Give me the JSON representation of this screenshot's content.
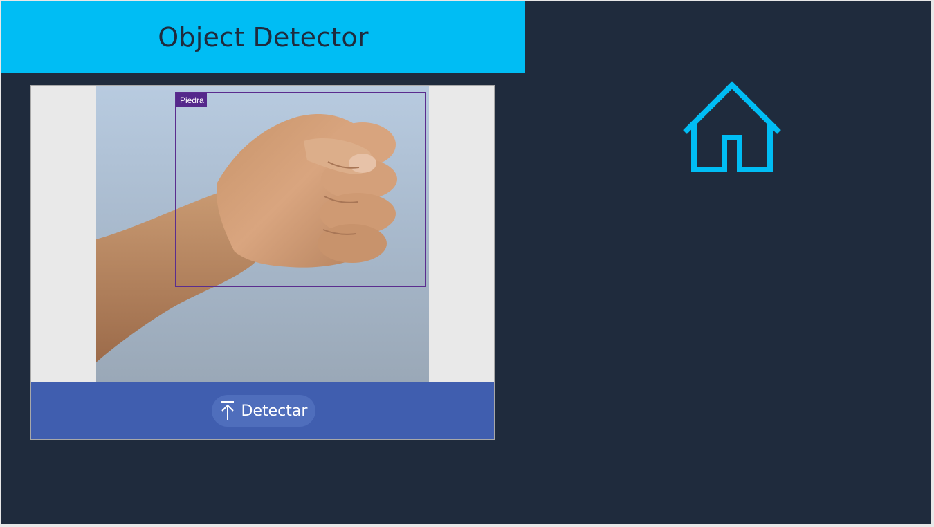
{
  "app": {
    "title": "Object Detector"
  },
  "detection": {
    "label": "Piedra",
    "image_icon": "raised-fist-photo"
  },
  "actions": {
    "detect_label": "Detectar",
    "detect_icon": "upload-arrow-icon",
    "home_icon": "home-icon"
  },
  "colors": {
    "header": "#00bdf4",
    "background": "#1f2b3d",
    "action_bar": "#405eaf",
    "detect_button": "#4f6ebc",
    "bounding_box": "#5b2d8e",
    "home_icon": "#00bdf4"
  }
}
